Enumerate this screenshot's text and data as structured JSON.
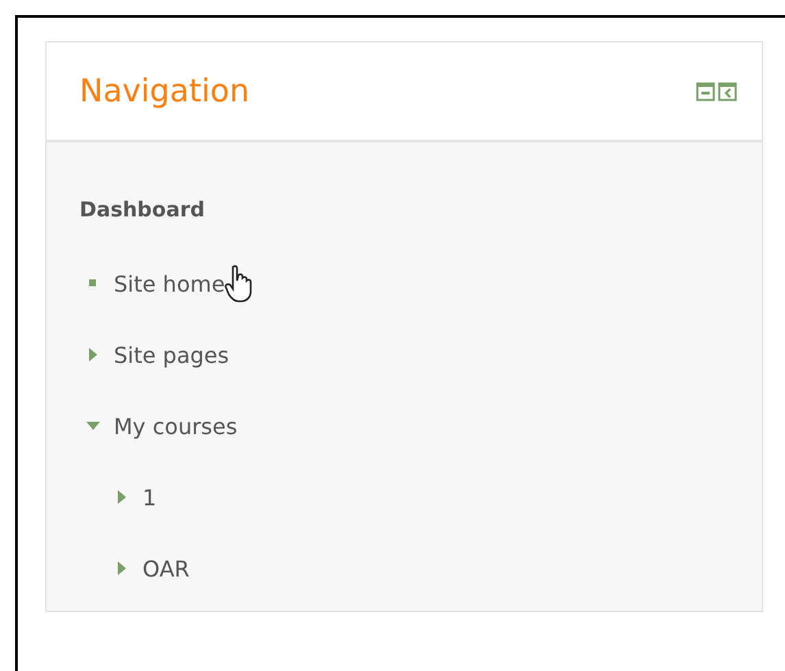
{
  "block": {
    "title": "Navigation"
  },
  "tree": [
    {
      "label": "Dashboard",
      "kind": "heading"
    },
    {
      "label": "Site home",
      "kind": "leaf"
    },
    {
      "label": "Site pages",
      "kind": "branch",
      "expanded": false
    },
    {
      "label": "My courses",
      "kind": "branch",
      "expanded": true,
      "children": [
        {
          "label": "1",
          "kind": "branch",
          "expanded": false
        },
        {
          "label": "OAR",
          "kind": "branch",
          "expanded": false
        }
      ]
    }
  ]
}
